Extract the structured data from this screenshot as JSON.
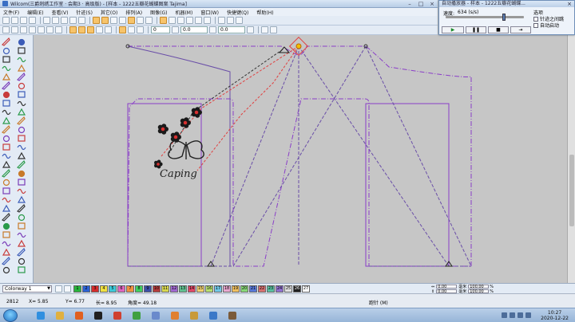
{
  "window": {
    "title": "Wilcom(三爵刺绣工作室 · 会期3 · 高级版) - [样本 - 1222五瓣花蝴蝶图案    Tajima]",
    "controls": [
      "–",
      "□",
      "×"
    ]
  },
  "menu": [
    "文件(F)",
    "编辑(E)",
    "查看(V)",
    "针迹(S)",
    "其它(O)",
    "排列(A)",
    "图像(G)",
    "机器(M)",
    "窗口(W)",
    "快捷键(Q)",
    "帮助(H)"
  ],
  "toolbar": {
    "field_values": [
      "0",
      "0.0",
      "0.0"
    ],
    "icons": [
      "new-icon",
      "open-icon",
      "save-icon",
      "print-icon",
      "cut-icon",
      "copy-icon",
      "paste-icon",
      "undo-icon",
      "redo-icon",
      "zoom-icon",
      "travel-icon",
      "grid-icon"
    ]
  },
  "stitch_player": {
    "title": "自动播放器 - 样本 - 1222五瓣花蝴蝶...",
    "close": "×",
    "speed_label": "速度:",
    "speed_value": "634 (s/s)",
    "speed_level": 0.75,
    "options_label": "选项",
    "option_1": "针迹之间跳",
    "option_2": "自动启动",
    "buttons": [
      "▶",
      "❚❚",
      "■",
      "⇥"
    ]
  },
  "colorway": {
    "selected": "Colorway 1",
    "swatches": [
      {
        "n": "1",
        "c": "#28b43c"
      },
      {
        "n": "2",
        "c": "#2c62d4"
      },
      {
        "n": "3",
        "c": "#d42c2c"
      },
      {
        "n": "4",
        "c": "#f0e040"
      },
      {
        "n": "5",
        "c": "#3cc8d8"
      },
      {
        "n": "6",
        "c": "#e066c0"
      },
      {
        "n": "7",
        "c": "#f09040"
      },
      {
        "n": "8",
        "c": "#40d060"
      },
      {
        "n": "9",
        "c": "#3c50a8"
      },
      {
        "n": "10",
        "c": "#b43c3c"
      },
      {
        "n": "11",
        "c": "#d8d850"
      },
      {
        "n": "12",
        "c": "#a068d0"
      },
      {
        "n": "13",
        "c": "#60c090"
      },
      {
        "n": "14",
        "c": "#e04868"
      },
      {
        "n": "15",
        "c": "#f0d070"
      },
      {
        "n": "16",
        "c": "#b8e070"
      },
      {
        "n": "17",
        "c": "#70c8e8"
      },
      {
        "n": "18",
        "c": "#e8a8d0"
      },
      {
        "n": "19",
        "c": "#f0c060"
      },
      {
        "n": "20",
        "c": "#88d878"
      },
      {
        "n": "21",
        "c": "#5878d8"
      },
      {
        "n": "22",
        "c": "#d87070"
      },
      {
        "n": "23",
        "c": "#58c0a0"
      },
      {
        "n": "24",
        "c": "#9070d0"
      },
      {
        "n": "25",
        "c": "#e0e0e0"
      },
      {
        "n": "26",
        "c": "#202020"
      },
      {
        "n": "27",
        "c": "#ffffff"
      }
    ]
  },
  "dimensions": {
    "w_value": "0.00",
    "w_unit": "毫米",
    "w_pct": "100.00",
    "h_value": "0.00",
    "h_unit": "毫米",
    "h_pct": "100.00"
  },
  "status": {
    "stitch_count": "2812",
    "x": "X=  5.85",
    "y": "Y=  6.77",
    "l": "长=  8.95",
    "angle": "角度= 49.18",
    "mode": "跑针 (M)"
  },
  "design": {
    "lettering": "Caping"
  },
  "taskbar": {
    "apps": [
      {
        "name": "taskbar-ie-icon",
        "c": "#2f8fe0"
      },
      {
        "name": "taskbar-explorer-icon",
        "c": "#e0b040"
      },
      {
        "name": "taskbar-media-icon",
        "c": "#e06020"
      },
      {
        "name": "taskbar-qq-icon",
        "c": "#202020"
      },
      {
        "name": "taskbar-browser-icon",
        "c": "#d04030"
      },
      {
        "name": "taskbar-chrome-icon",
        "c": "#40a040"
      },
      {
        "name": "taskbar-pen-icon",
        "c": "#6a8acc"
      },
      {
        "name": "taskbar-app-icon",
        "c": "#e08030"
      },
      {
        "name": "taskbar-folder-icon",
        "c": "#c89a3a"
      },
      {
        "name": "taskbar-screen-icon",
        "c": "#3a78c8"
      },
      {
        "name": "taskbar-wilcom-icon",
        "c": "#7a5a3a"
      }
    ],
    "time": "10:27",
    "date": "2020-12-22"
  },
  "colors": {
    "outline": "#8a3ec8",
    "guide": "#6a4ea8",
    "travel_red": "#e04040"
  }
}
